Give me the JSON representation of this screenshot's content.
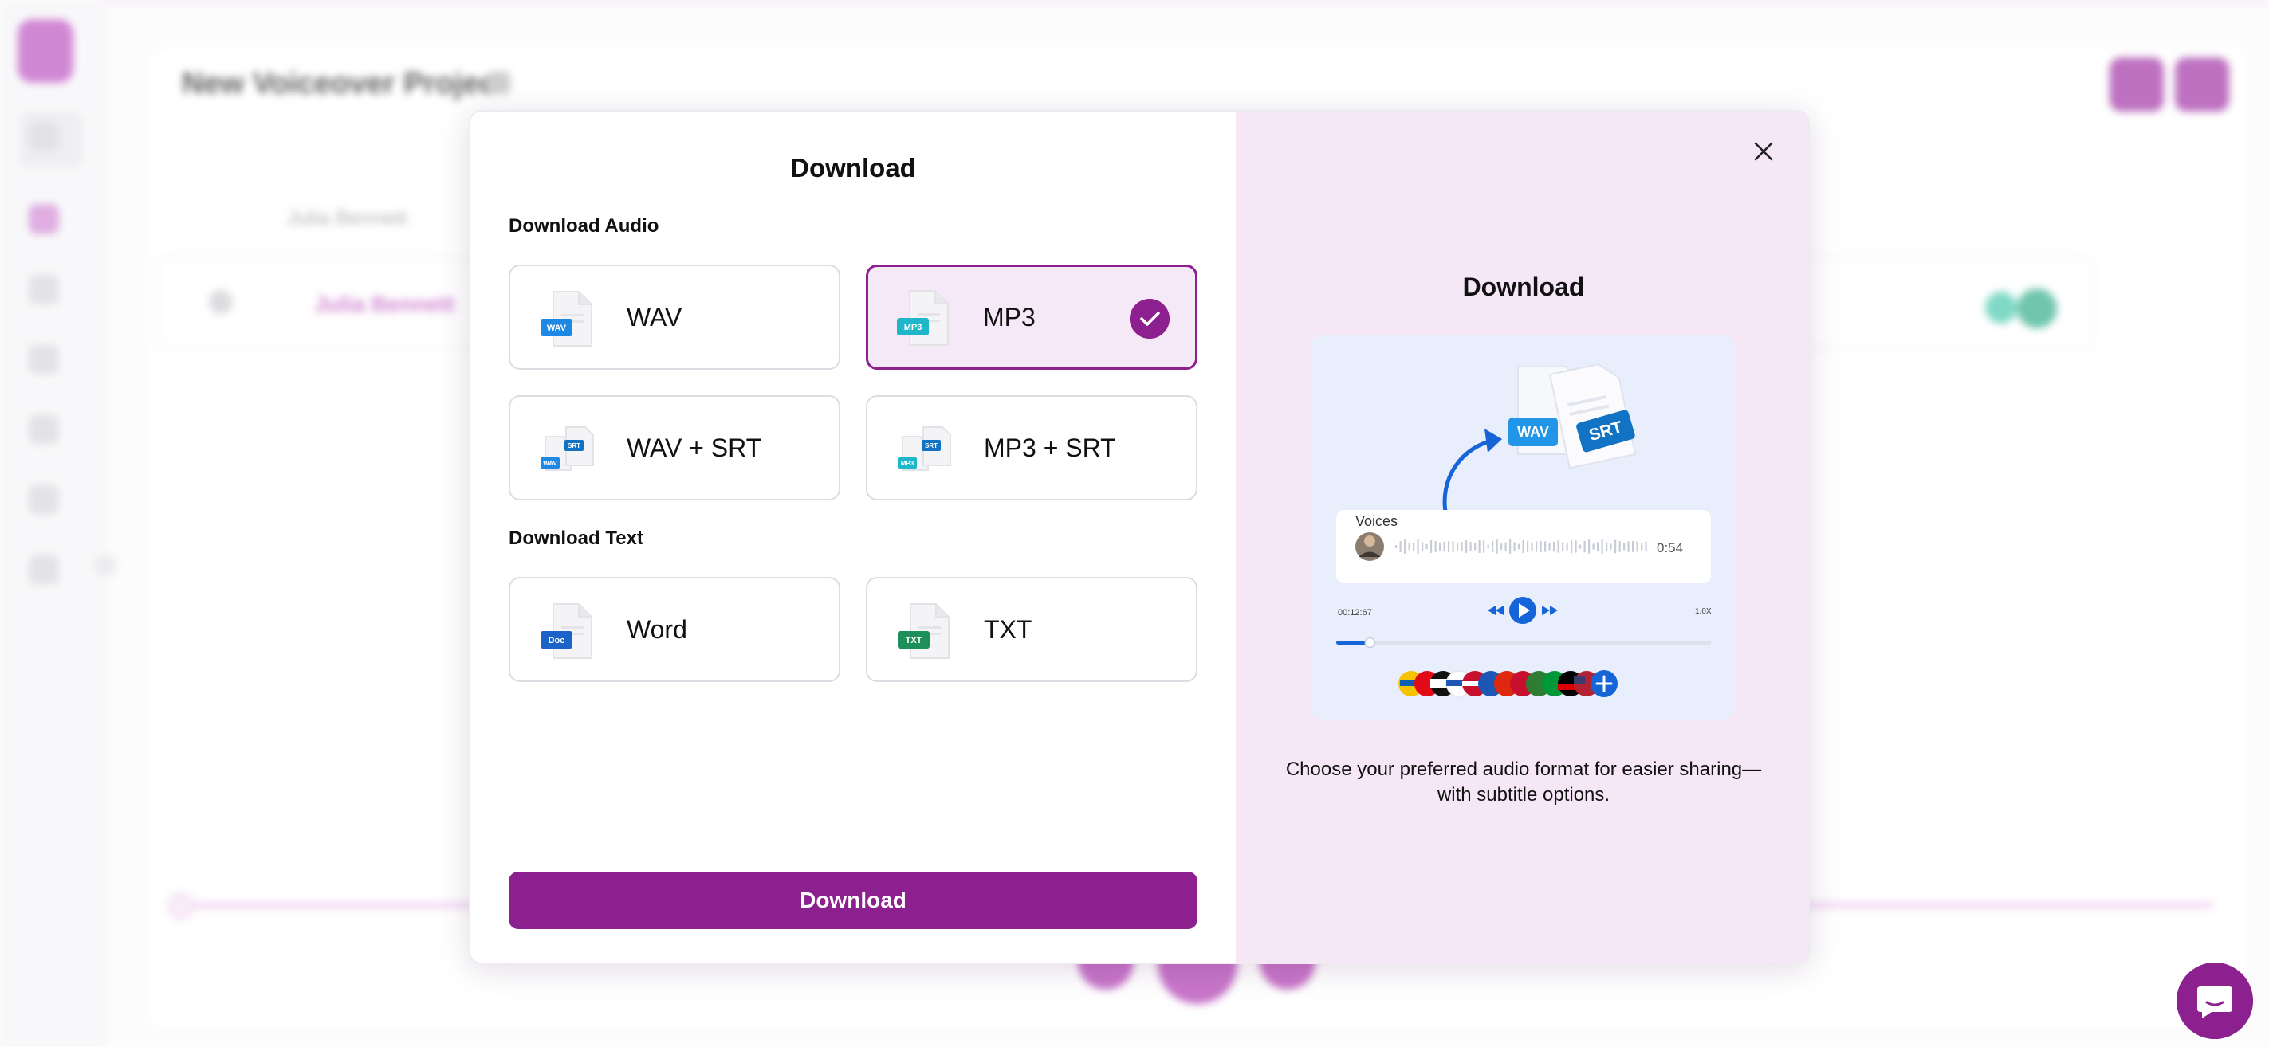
{
  "background": {
    "project_title": "New Voiceover Project",
    "voice_tab": "Julia Bennett",
    "row_voice": "Julia Bennett"
  },
  "modal": {
    "title": "Download",
    "audio_section": "Download Audio",
    "text_section": "Download Text",
    "options": {
      "wav": {
        "label": "WAV",
        "badge": "WAV",
        "selected": false
      },
      "mp3": {
        "label": "MP3",
        "badge": "MP3",
        "selected": true
      },
      "wav_srt": {
        "label": "WAV + SRT",
        "badge": "WAV",
        "badge2": "SRT",
        "selected": false
      },
      "mp3_srt": {
        "label": "MP3 + SRT",
        "badge": "MP3",
        "badge2": "SRT",
        "selected": false
      },
      "word": {
        "label": "Word",
        "badge": "Doc",
        "selected": false
      },
      "txt": {
        "label": "TXT",
        "badge": "TXT",
        "selected": false
      }
    },
    "download_button": "Download",
    "preview": {
      "title": "Download",
      "description_line1": "Choose your preferred audio format for easier sharing—",
      "description_line2": "with subtitle options.",
      "illustration": {
        "wav_tag": "WAV",
        "srt_tag": "SRT",
        "voices_label": "Voices",
        "duration": "0:54",
        "current_time": "00:12:67",
        "speed": "1.0X",
        "progress": 0.09
      }
    }
  },
  "colors": {
    "brand": "#8b208e",
    "selected_bg": "#f6e9f7",
    "preview_bg": "#f5e7f6",
    "wav_badge": "#1e88e5",
    "mp3_badge": "#1fb6c9",
    "srt_badge": "#1273c4",
    "doc_badge": "#1c63c8",
    "txt_badge": "#1e8e5a",
    "player_blue": "#1565d8"
  },
  "icons": {
    "close": "close-icon",
    "check": "check-icon",
    "chat": "chat-bubble-icon"
  }
}
